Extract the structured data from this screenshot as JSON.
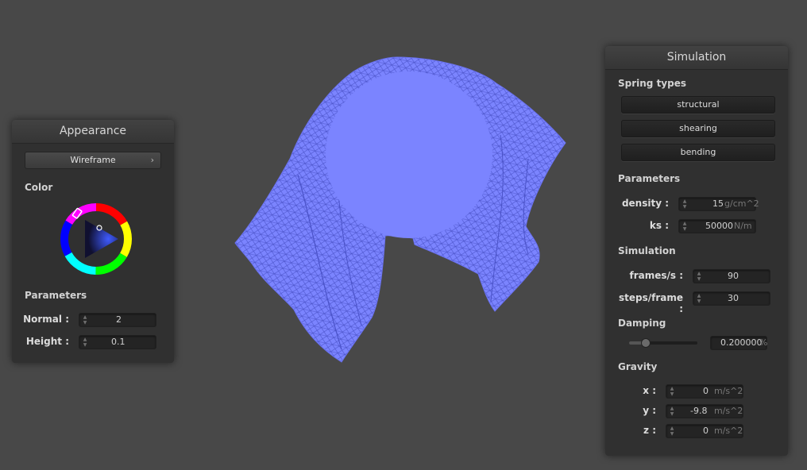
{
  "colors": {
    "background": "#484848",
    "cloth": "#7b84ff",
    "wire": "#4a52c8"
  },
  "appearance": {
    "title": "Appearance",
    "shading_mode": "Wireframe",
    "color_label": "Color",
    "parameters_label": "Parameters",
    "normal_label": "Normal :",
    "normal_value": "2",
    "height_label": "Height :",
    "height_value": "0.1"
  },
  "simulation": {
    "title": "Simulation",
    "spring_types_label": "Spring types",
    "spring_types": [
      "structural",
      "shearing",
      "bending"
    ],
    "parameters_label": "Parameters",
    "density_label": "density :",
    "density_value": "15",
    "density_unit": "g/cm^2",
    "ks_label": "ks :",
    "ks_value": "50000",
    "ks_unit": "N/m",
    "simulation_label": "Simulation",
    "fps_label": "frames/s :",
    "fps_value": "90",
    "steps_label": "steps/frame :",
    "steps_value": "30",
    "damping_label": "Damping",
    "damping_value": "0.200000",
    "damping_unit": "%",
    "damping_slider_fraction": 0.2,
    "gravity_label": "Gravity",
    "gx_label": "x :",
    "gx_value": "0",
    "gy_label": "y :",
    "gy_value": "-9.8",
    "gz_label": "z :",
    "gz_value": "0",
    "gravity_unit": "m/s^2"
  }
}
